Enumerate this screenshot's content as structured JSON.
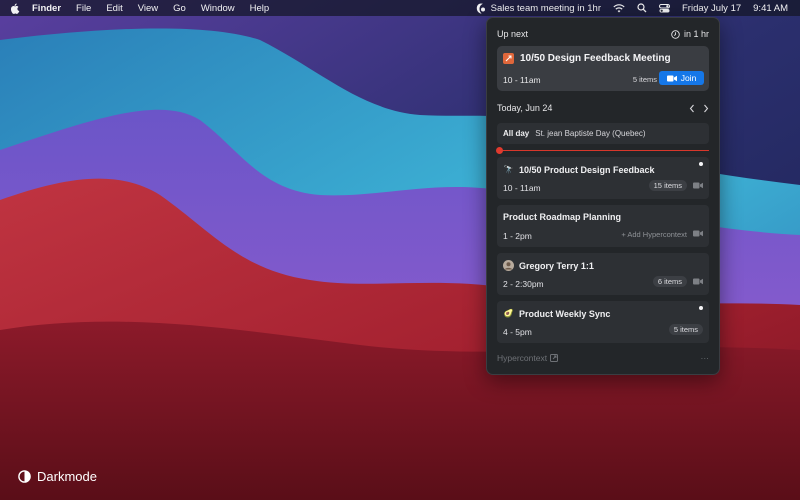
{
  "menubar": {
    "items": [
      "Finder",
      "File",
      "Edit",
      "View",
      "Go",
      "Window",
      "Help"
    ],
    "status_text": "Sales team meeting in 1hr",
    "date": "Friday July 17",
    "time": "9:41 AM"
  },
  "popover": {
    "header": {
      "title": "Up next",
      "countdown": "in 1 hr"
    },
    "next_meeting": {
      "title": "10/50 Design Feedback Meeting",
      "time": "10 - 11am",
      "items": "5 items",
      "join_label": "Join"
    },
    "day": {
      "label": "Today, Jun 24"
    },
    "all_day": {
      "label": "All day",
      "event": "St. jean Baptiste Day (Quebec)"
    },
    "events": [
      {
        "title": "10/50 Product Design Feedback",
        "time": "10 - 11am",
        "badge": "15 items",
        "emoji": "🔭"
      },
      {
        "title": "Product Roadmap Planning",
        "time": "1 - 2pm",
        "add": "+ Add Hypercontext"
      },
      {
        "title": "Gregory Terry 1:1",
        "time": "2 - 2:30pm",
        "badge": "6 items"
      },
      {
        "title": "Product Weekly Sync",
        "time": "4 - 5pm",
        "badge": "5 items",
        "emoji": "🥑"
      }
    ],
    "footer": {
      "brand": "Hypercontext",
      "more": "···"
    }
  },
  "desktop": {
    "label": "Darkmode"
  },
  "colors": {
    "accent": "#1577e8",
    "now_line": "#d8372b",
    "popover_bg": "#232629"
  },
  "icons": [
    "apple-icon",
    "hypercontext-icon",
    "wifi-icon",
    "search-icon",
    "control-center-icon",
    "clock-icon",
    "video-camera-icon",
    "chevron-left-icon",
    "chevron-right-icon",
    "external-link-icon",
    "contrast-icon"
  ]
}
